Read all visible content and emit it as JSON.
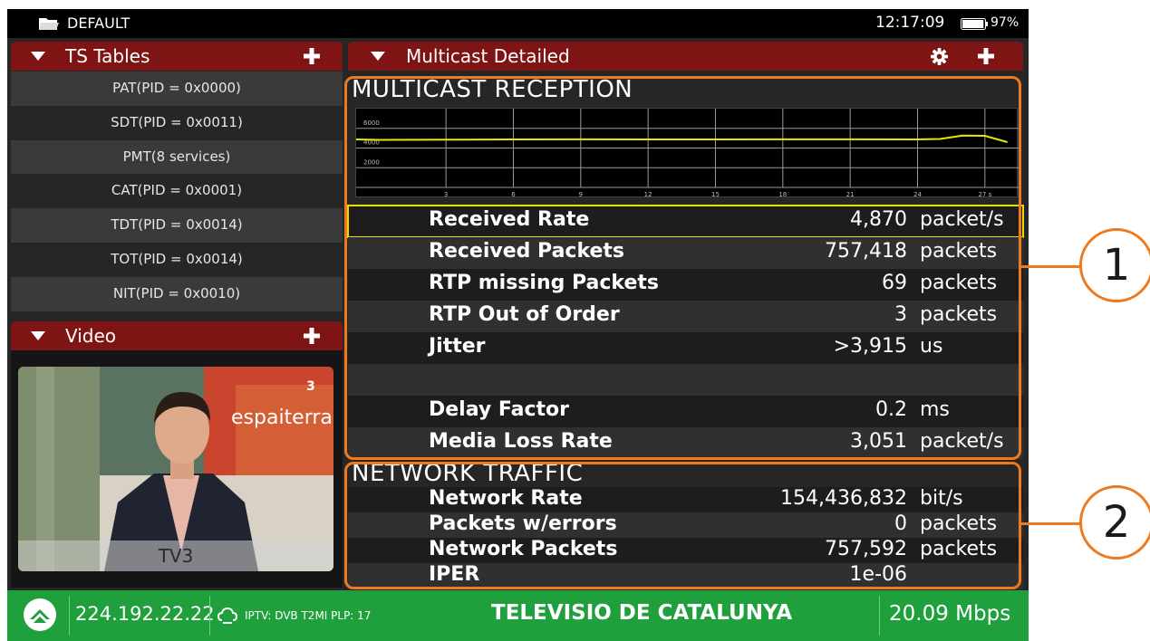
{
  "topbar": {
    "profile": "DEFAULT",
    "time": "12:17:09",
    "battery": "97%",
    "battery_level": 0.97
  },
  "ts_tables": {
    "title": "TS Tables",
    "items": [
      "PAT(PID = 0x0000)",
      "SDT(PID = 0x0011)",
      "PMT(8 services)",
      "CAT(PID = 0x0001)",
      "TDT(PID = 0x0014)",
      "TOT(PID = 0x0014)",
      "NIT(PID = 0x0010)"
    ]
  },
  "video": {
    "title": "Video",
    "channel_overlay": "TV3",
    "banner_text": "espaiterra",
    "banner_number": "3"
  },
  "multicast": {
    "title": "Multicast Detailed",
    "section_title": "MULTICAST RECEPTION",
    "rows": [
      {
        "label": "Received Rate",
        "value": "4,870",
        "unit": "packet/s"
      },
      {
        "label": "Received Packets",
        "value": "757,418",
        "unit": "packets"
      },
      {
        "label": "RTP missing Packets",
        "value": "69",
        "unit": "packets"
      },
      {
        "label": "RTP Out of Order",
        "value": "3",
        "unit": "packets"
      },
      {
        "label": "Jitter",
        "value": ">3,915",
        "unit": "us"
      },
      {
        "label": "",
        "value": "",
        "unit": ""
      },
      {
        "label": "Delay Factor",
        "value": "0.2",
        "unit": "ms"
      },
      {
        "label": "Media Loss Rate",
        "value": "3,051",
        "unit": "packet/s"
      }
    ]
  },
  "chart_data": {
    "type": "line",
    "title": "",
    "xlabel": "",
    "ylabel": "",
    "ylim": [
      0,
      8000
    ],
    "xlim": [
      -1,
      28.5
    ],
    "y_ticks": [
      "6000",
      "4000",
      "2000"
    ],
    "x_ticks": [
      "3",
      "6",
      "9",
      "12",
      "15",
      "18",
      "21",
      "24",
      "27 s"
    ],
    "grid": true,
    "series": [
      {
        "color": "#e8e800",
        "x": [
          -1,
          0,
          3,
          6,
          9,
          12,
          15,
          18,
          21,
          24,
          25,
          26,
          27,
          28
        ],
        "values": [
          4870,
          4830,
          4850,
          4870,
          4880,
          4870,
          4870,
          4880,
          4880,
          4870,
          4920,
          5260,
          5240,
          4600
        ]
      }
    ]
  },
  "network": {
    "section_title": "NETWORK TRAFFIC",
    "rows": [
      {
        "label": "Network Rate",
        "value": "154,436,832",
        "unit": "bit/s"
      },
      {
        "label": "Packets w/errors",
        "value": "0",
        "unit": "packets"
      },
      {
        "label": "Network Packets",
        "value": "757,592",
        "unit": "packets"
      },
      {
        "label": "IPER",
        "value": "1e-06",
        "unit": ""
      }
    ]
  },
  "bottombar": {
    "ip": "224.192.22.22",
    "iptv": "IPTV: DVB T2MI PLP: 17",
    "channel": "TELEVISIO DE CATALUNYA",
    "bitrate": "20.09 Mbps"
  },
  "annotations": [
    "1",
    "2"
  ],
  "colors": {
    "panel_header": "#7e1414",
    "status_bar": "#20a03c",
    "annotation": "#ef7a1d",
    "trace": "#e8e800",
    "selection": "#e8dc00"
  }
}
